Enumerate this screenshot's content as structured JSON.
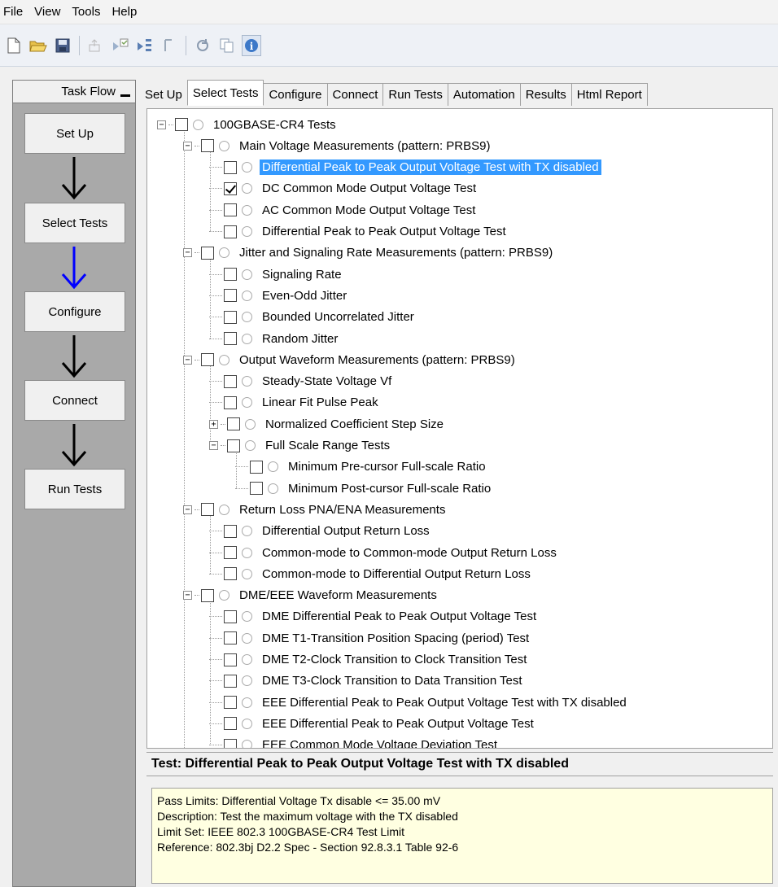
{
  "menu": [
    "File",
    "View",
    "Tools",
    "Help"
  ],
  "toolbar": {
    "icons": [
      "new-file-icon",
      "open-folder-icon",
      "save-icon",
      "export-icon",
      "run-checked-icon",
      "run-all-icon",
      "stop-icon",
      "refresh-icon",
      "copy-icon",
      "info-icon"
    ]
  },
  "taskflow": {
    "title": "Task Flow",
    "steps": [
      "Set Up",
      "Select Tests",
      "Configure",
      "Connect",
      "Run Tests"
    ],
    "active_arrow_color": "#0000ff"
  },
  "tabs": [
    "Set Up",
    "Select Tests",
    "Configure",
    "Connect",
    "Run Tests",
    "Automation",
    "Results",
    "Html Report"
  ],
  "active_tab": "Select Tests",
  "tree": {
    "root": "100GBASE-CR4 Tests",
    "groups": [
      {
        "label": "Main Voltage Measurements (pattern: PRBS9)",
        "items": [
          {
            "label": "Differential Peak to Peak Output Voltage Test with TX disabled",
            "checked": false,
            "selected": true
          },
          {
            "label": "DC Common Mode Output Voltage Test",
            "checked": true
          },
          {
            "label": "AC Common Mode Output Voltage Test",
            "checked": false
          },
          {
            "label": "Differential Peak to Peak Output Voltage Test",
            "checked": false
          }
        ]
      },
      {
        "label": "Jitter and Signaling Rate Measurements (pattern: PRBS9)",
        "items": [
          {
            "label": "Signaling Rate"
          },
          {
            "label": "Even-Odd Jitter"
          },
          {
            "label": "Bounded Uncorrelated Jitter"
          },
          {
            "label": "Random Jitter"
          }
        ]
      },
      {
        "label": "Output Waveform Measurements (pattern: PRBS9)",
        "items": [
          {
            "label": "Steady-State Voltage Vf"
          },
          {
            "label": "Linear Fit Pulse Peak"
          },
          {
            "label": "Normalized Coefficient Step Size",
            "expander": "+"
          },
          {
            "label": "Full Scale Range Tests",
            "expander": "-",
            "children": [
              "Minimum Pre-cursor Full-scale Ratio",
              "Minimum Post-cursor Full-scale Ratio"
            ]
          }
        ]
      },
      {
        "label": "Return Loss PNA/ENA Measurements",
        "items": [
          {
            "label": "Differential Output Return Loss"
          },
          {
            "label": "Common-mode to Common-mode Output Return Loss"
          },
          {
            "label": "Common-mode to Differential Output Return Loss"
          }
        ]
      },
      {
        "label": "DME/EEE Waveform Measurements",
        "items": [
          {
            "label": "DME Differential Peak to Peak Output Voltage Test"
          },
          {
            "label": "DME T1-Transition Position Spacing (period) Test"
          },
          {
            "label": "DME T2-Clock Transition to Clock Transition Test"
          },
          {
            "label": "DME T3-Clock Transition to Data Transition Test"
          },
          {
            "label": "EEE Differential Peak to Peak Output Voltage Test with TX disabled"
          },
          {
            "label": "EEE Differential Peak to Peak Output Voltage Test"
          },
          {
            "label": "EEE Common Mode Voltage Deviation Test"
          }
        ]
      }
    ]
  },
  "detail": {
    "title": "Test: Differential Peak to Peak Output Voltage Test with TX disabled",
    "pass_limits": "Pass Limits: Differential Voltage Tx disable <= 35.00 mV",
    "description": "Description: Test the maximum voltage with the TX disabled",
    "limit_set": "Limit Set: IEEE 802.3 100GBASE-CR4 Test Limit",
    "reference": "Reference: 802.3bj D2.2 Spec - Section 92.8.3.1 Table 92-6"
  }
}
